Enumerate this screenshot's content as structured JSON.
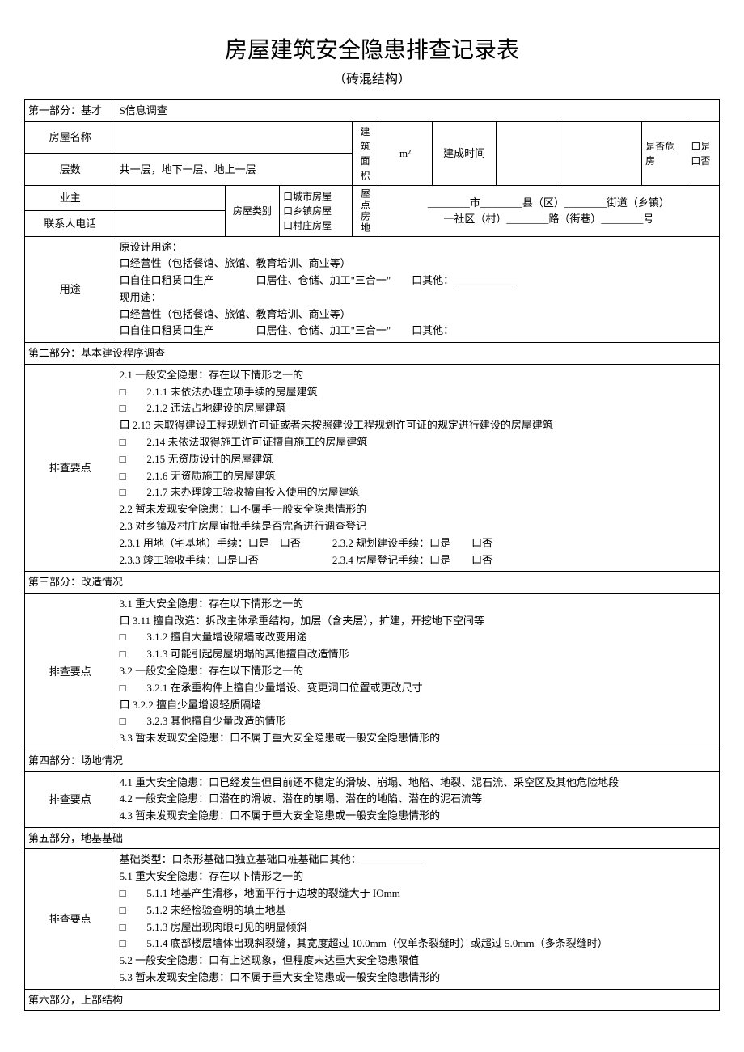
{
  "title": "房屋建筑安全隐患排查记录表",
  "subtitle": "（砖混结构）",
  "section1": {
    "header_a": "第一部分：基才",
    "header_b": "S信息调查",
    "house_name_label": "房屋名称",
    "floors_label": "层数",
    "floors_value": "共一层，地下一层、地上一层",
    "area_label": "建筑面积",
    "area_value": "m²",
    "build_time_label": "建成时间",
    "danger_label": "是否危房",
    "danger_yes": "口是",
    "danger_no": "口否",
    "owner_label": "业主",
    "contact_label": "联系人电话",
    "house_type_label": "房屋类别",
    "house_type_options": "口城市房屋\n口乡镇房屋\n口村庄房屋",
    "location_label": "屋点房地",
    "location_line1": "________市________县（区）________街道（乡镇）",
    "location_line2": "一社区（村）________路（街巷）________号",
    "usage_label": "用途",
    "usage_content": "原设计用途：\n口经营性（包括餐馆、旅馆、教育培训、商业等）\n口自住口租赁口生产　　　　口居住、仓储、加工\"三合一\"　　口其他：____________\n现用途：\n口经营性（包括餐馆、旅馆、教育培训、商业等）\n口自住口租赁口生产　　　　口居住、仓储、加工\"三合一\"　　口其他："
  },
  "section2": {
    "header": "第二部分：基本建设程序调查",
    "points_label": "排查要点",
    "content": "2.1 一般安全隐患：存在以下情形之一的\n□　　2.1.1 未依法办理立项手续的房屋建筑\n□　　2.1.2 违法占地建设的房屋建筑\n口 2.13 未取得建设工程规划许可证或者未按照建设工程规划许可证的规定进行建设的房屋建筑\n□　　2.14 未依法取得施工许可证擅自施工的房屋建筑\n□　　2.15 无资质设计的房屋建筑\n□　　2.1.6 无资质施工的房屋建筑\n□　　2.1.7 未办理竣工验收擅自投入使用的房屋建筑\n2.2 暂未发现安全隐患：口不属手一般安全隐患情形的\n2.3 对乡镇及村庄房屋审批手续是否完备进行调查登记\n2.3.1 用地（宅基地）手续：口是　口否　　　2.3.2 规划建设手续：口是　　口否\n2.3.3 竣工验收手续：口是口否　　　　　　　2.3.4 房屋登记手续：口是　　口否"
  },
  "section3": {
    "header": "第三部分：改造情况",
    "points_label": "排查要点",
    "content": "3.1 重大安全隐患：存在以下情形之一的\n口 3.11 擅自改造：拆改主体承重结构，加层（含夹层），扩建，开挖地下空间等\n□　　3.1.2 擅自大量增设隔墙或改变用途\n□　　3.1.3 可能引起房屋坍塌的其他擅自改造情形\n3.2 一般安全隐患：存在以下情形之一的\n□　　3.2.1 在承重构件上擅自少量增设、变更洞口位置或更改尺寸\n口 3.2.2 擅自少量增设轻质隔墙\n□　　3.2.3 其他擅自少量改造的情形\n3.3 暂未发现安全隐患：口不属于重大安全隐患或一般安全隐患情形的"
  },
  "section4": {
    "header": "第四部分：场地情况",
    "points_label": "排查要点",
    "content": "4.1 重大安全隐患：口已经发生但目前还不稳定的滑坡、崩塌、地陷、地裂、泥石流、采空区及其他危险地段\n4.2 一般安全隐患：口潜在的滑坡、潜在的崩塌、潜在的地陷、潜在的泥石流等\n4.3 暂未发现安全隐患：口不属于重大安全隐患或一般安全隐患情形的"
  },
  "section5": {
    "header": "第五部分，地基基础",
    "points_label": "排查要点",
    "content": "基础类型：口条形基础口独立基础口桩基础口其他：____________\n5.1 重大安全隐患：存在以下情形之一的\n□　　5.1.1 地基产生滑移，地面平行于边坡的裂缝大于 IOmm\n□　　5.1.2 未经检验查明的填土地基\n□　　5.1.3 房屋出现肉眼可见的明显倾斜\n□　　5.1.4 底部楼层墙体出现斜裂缝，其宽度超过 10.0mm（仅单条裂缝时）或超过 5.0mm（多条裂缝时）\n5.2 一般安全隐患：口有上述现象，但程度未达重大安全隐患限值\n5.3 暂未发现安全隐患：口不属于重大安全隐患或一般安全隐患情形的"
  },
  "section6": {
    "header": "第六部分，上部结构"
  }
}
